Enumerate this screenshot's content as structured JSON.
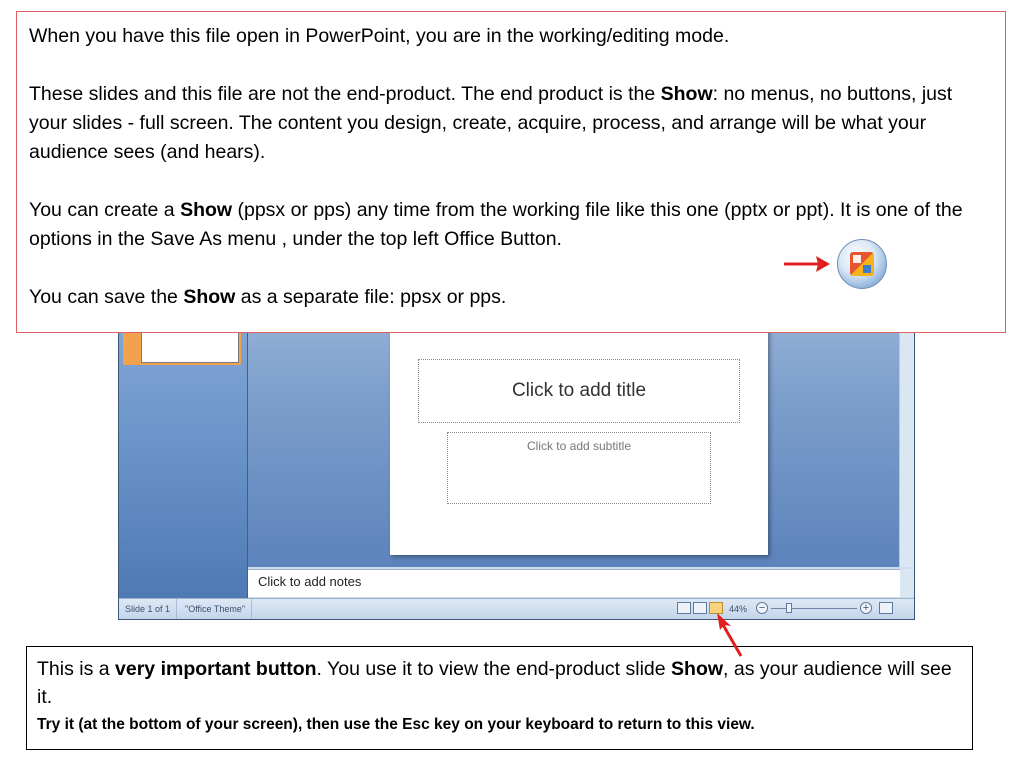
{
  "top_box": {
    "line1": "When you have this file open in PowerPoint, you are in the working/editing mode.",
    "p2_a": "These slides and this file are not the end-product. The end product is the ",
    "p2_bold": "Show",
    "p2_b": ": no menus, no buttons, just your slides - full screen. The content you design, create, acquire, process, and arrange will be what your audience sees (and hears).",
    "p3_a": "You can create a ",
    "p3_bold": "Show",
    "p3_b": " (ppsx or pps) any time from the working file like this one (pptx or ppt). It is one of the options in the Save As menu , under the top left Office Button.",
    "p4_a": "You can save the ",
    "p4_bold": "Show",
    "p4_b": " as a separate file: ppsx or pps."
  },
  "office_button": {
    "icon": "office-logo-icon"
  },
  "ppt": {
    "title_placeholder": "Click to add title",
    "subtitle_placeholder": "Click to add subtitle",
    "notes_placeholder": "Click to add notes",
    "status": {
      "slide_info": "Slide 1 of 1",
      "theme": "\"Office Theme\"",
      "zoom": "44%",
      "zoom_out": "−",
      "zoom_in": "+"
    }
  },
  "bottom_box": {
    "a": "This is a ",
    "bold1": "very important button",
    "b": ".  You use it to view the end-product slide ",
    "bold2": "Show",
    "c": ", as your audience will see it.",
    "sub": "Try it (at the bottom of your screen), then use the Esc key on your keyboard to return to this view."
  },
  "colors": {
    "arrow": "#e02020",
    "top_border": "#e06060",
    "active_view": "#f7d37d"
  }
}
